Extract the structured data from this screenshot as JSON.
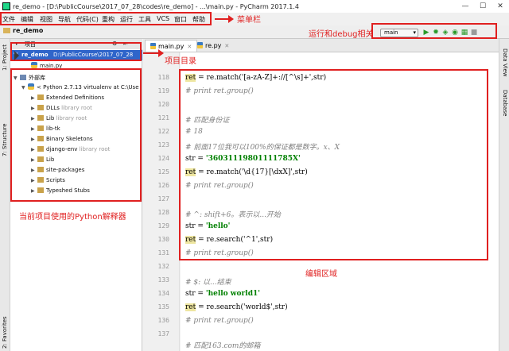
{
  "window": {
    "title": "re_demo - [D:\\PublicCourse\\2017_07_28\\codes\\re_demo] - ...\\main.py - PyCharm 2017.1.4",
    "minimize": "—",
    "maximize": "☐",
    "close": "✕"
  },
  "menubar": {
    "items": [
      "文件",
      "编辑",
      "视图",
      "导航",
      "代码(C)",
      "重构",
      "运行",
      "工具",
      "VCS",
      "窗口",
      "帮助"
    ]
  },
  "navbar": {
    "breadcrumb": "re_demo"
  },
  "run_toolbar": {
    "config": "main",
    "run_icon": "play-icon",
    "debug_icon": "bug-icon",
    "coverage_icon": "coverage-icon",
    "profile_icon": "profile-icon",
    "concurrency_icon": "concurrency-icon",
    "stop_icon": "stop-icon"
  },
  "left_strip": {
    "project": "1: Project",
    "structure": "7: Structure",
    "favorites": "2: Favorites"
  },
  "right_strip": {
    "data_view": "Data View",
    "database": "Database"
  },
  "project_panel": {
    "header": "项目",
    "root_name": "re_demo",
    "root_path": "D:\\PublicCourse\\2017_07_28",
    "files": [
      "main.py"
    ],
    "external_libs": "外部库",
    "interpreter": "< Python 2.7.13 virtualenv at C:\\Use",
    "items": [
      {
        "label": "Extended Definitions",
        "note": ""
      },
      {
        "label": "DLLs",
        "note": "library root"
      },
      {
        "label": "Lib",
        "note": "library root"
      },
      {
        "label": "lib-tk",
        "note": ""
      },
      {
        "label": "Binary Skeletons",
        "note": ""
      },
      {
        "label": "django-env",
        "note": "library root"
      },
      {
        "label": "Lib",
        "note": ""
      },
      {
        "label": "site-packages",
        "note": ""
      },
      {
        "label": "Scripts",
        "note": ""
      },
      {
        "label": "Typeshed Stubs",
        "note": ""
      }
    ]
  },
  "tabs": [
    {
      "label": "main.py",
      "active": true
    },
    {
      "label": "re.py",
      "active": false
    }
  ],
  "editor": {
    "line_numbers": [
      "118",
      "119",
      "120",
      "121",
      "122",
      "123",
      "124",
      "125",
      "126",
      "127",
      "128",
      "129",
      "130",
      "131",
      "132",
      "133",
      "134",
      "135",
      "136",
      "137"
    ],
    "lines": [
      {
        "ret": "ret",
        "rest": " = re.match('",
        "s": "[a-zA-Z]+://[^\\s]+",
        "end": "',str)"
      },
      {
        "comment": "# print ret.group()"
      },
      {
        "comment": "# 匹配身份证"
      },
      {
        "comment": "# 18"
      },
      {
        "comment": "# 前面17位我可以100%的保证都是数字。x、X"
      },
      {
        "pre": "str = ",
        "str": "'36031119801111785X'"
      },
      {
        "ret": "ret",
        "rest": " = re.match('",
        "s": "\\d{17}[\\dxX]",
        "end": "',str)"
      },
      {
        "comment": "# print ret.group()"
      },
      {
        "comment": "# ^: shift+6。表示以...开始"
      },
      {
        "pre": "str = ",
        "str": "'hello'"
      },
      {
        "ret": "ret",
        "rest": " = re.search('",
        "s": "^1",
        "end": "',str)"
      },
      {
        "comment": "# print ret.group()"
      },
      {
        "comment": "# $: 以...结束"
      },
      {
        "pre": "str = ",
        "str": "'hello world1'"
      },
      {
        "ret": "ret",
        "rest": " = re.search('",
        "s": "world$",
        "end": "',str)"
      },
      {
        "comment": "# print  ret.group()"
      },
      {
        "comment": "# 匹配163.com的邮箱"
      }
    ]
  },
  "annotations": {
    "menubar": "菜单栏",
    "run_debug": "运行和debug相关",
    "project_dir": "项目目录",
    "interpreter": "当前项目使用的Python解释器",
    "edit_area": "编辑区域"
  },
  "colors": {
    "annotation_red": "#e02020",
    "selection_blue": "#2f65ca",
    "comment_gray": "#808080",
    "string_green": "#008000"
  }
}
